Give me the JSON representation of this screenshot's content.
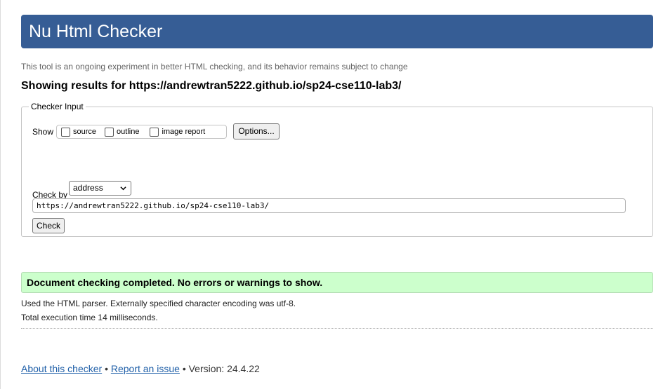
{
  "header": {
    "title": "Nu Html Checker"
  },
  "tagline": "This tool is an ongoing experiment in better HTML checking, and its behavior remains subject to change",
  "results_heading": "Showing results for https://andrewtran5222.github.io/sp24-cse110-lab3/",
  "checker_input": {
    "legend": "Checker Input",
    "show_label": "Show",
    "show_options": [
      {
        "label": "source",
        "checked": false
      },
      {
        "label": "outline",
        "checked": false
      },
      {
        "label": "image report",
        "checked": false
      }
    ],
    "options_button": "Options...",
    "check_by_label": "Check by",
    "check_by_value": "address",
    "url_value": "https://andrewtran5222.github.io/sp24-cse110-lab3/",
    "check_button": "Check"
  },
  "result": {
    "message": "Document checking completed. No errors or warnings to show.",
    "parser_info": "Used the HTML parser. Externally specified character encoding was utf-8.",
    "execution_time": "Total execution time 14 milliseconds."
  },
  "footer": {
    "about_link": "About this checker",
    "separator": "•",
    "report_link": "Report an issue",
    "version": "Version: 24.4.22"
  }
}
